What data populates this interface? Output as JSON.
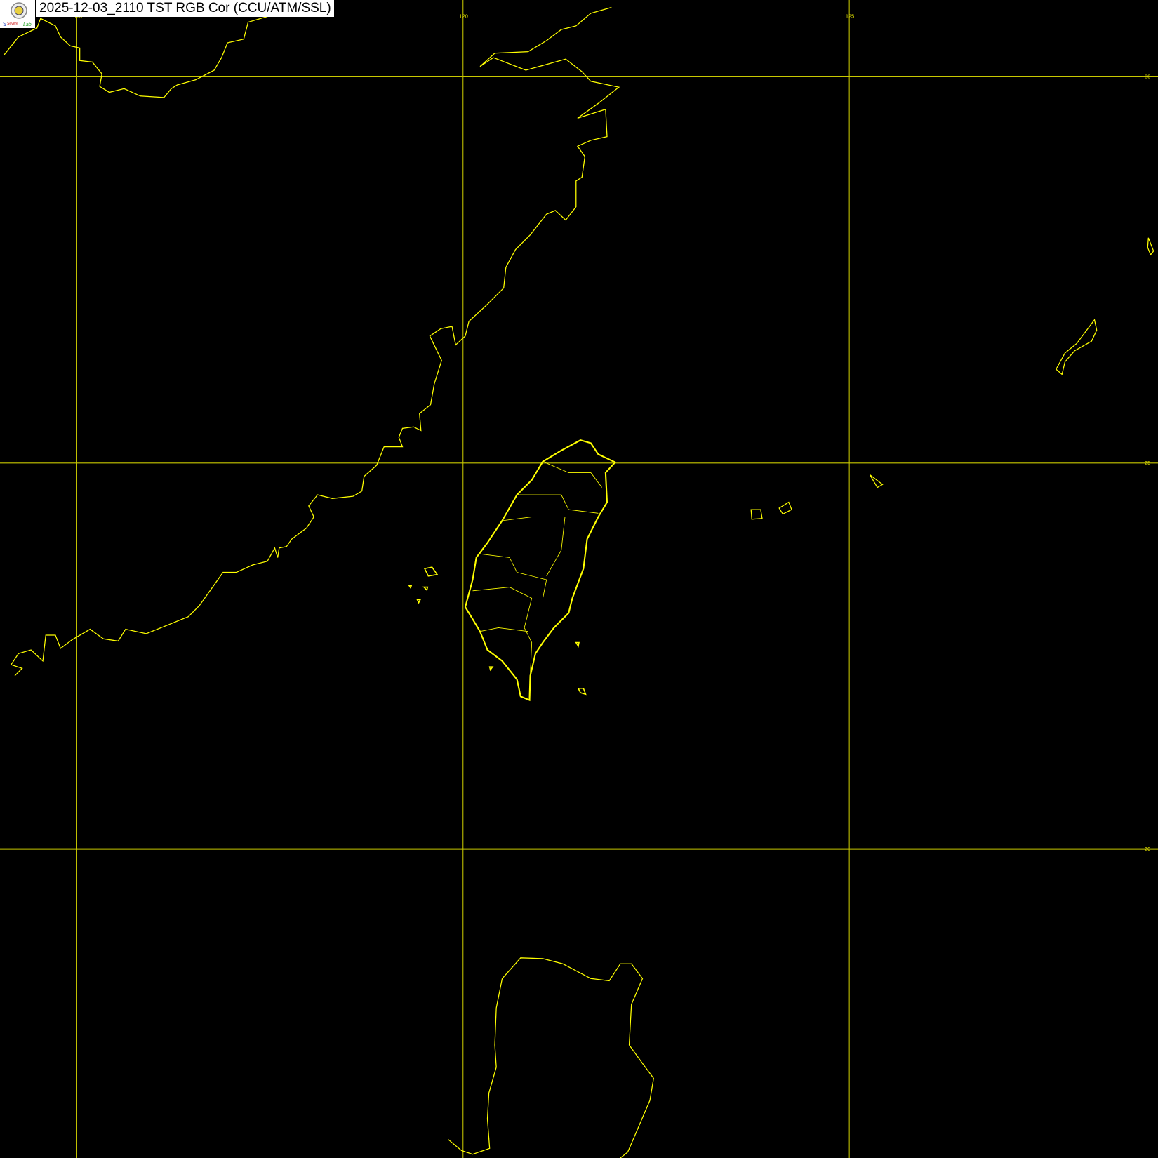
{
  "title": "2025-12-03_2110 TST RGB Cor (CCU/ATM/SSL)",
  "logo_text": "Severe Storms Lab.",
  "colors": {
    "background": "#000000",
    "coastline": "#ffff00",
    "grid": "#c8c800"
  },
  "grid": {
    "longitudes": [
      "115",
      "120",
      "125"
    ],
    "latitudes": [
      "30",
      "25",
      "20"
    ]
  }
}
